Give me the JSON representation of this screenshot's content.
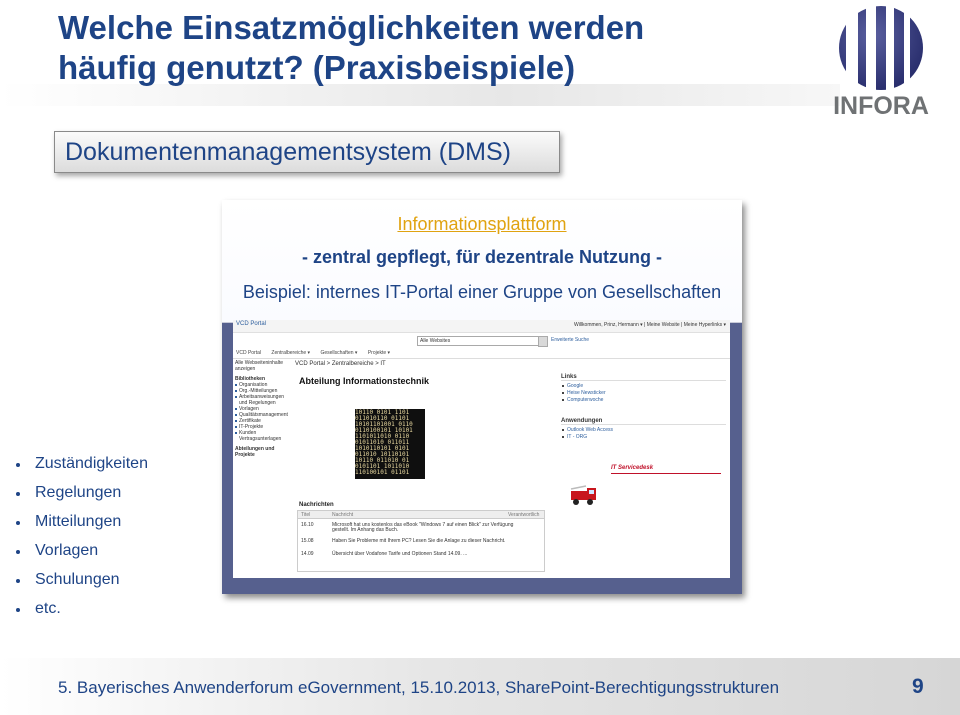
{
  "slide": {
    "title_line1": "Welche Einsatzmöglichkeiten werden",
    "title_line2": "häufig genutzt? (Praxisbeispiele)",
    "logo_text": "INFORA",
    "dms_label": "Dokumentenmanagementsystem (DMS)"
  },
  "panel": {
    "heading": "Informationsplattform",
    "subheading": "- zentral gepflegt, für dezentrale Nutzung -",
    "example": "Beispiel: internes IT-Portal einer Gruppe von Gesellschaften"
  },
  "portal": {
    "brand": "VCD Portal",
    "user_links": "Willkommen, Prinz, Hermann ▾ | Meine Website | Meine Hyperlinks ▾",
    "search_scope": "Alle Websites",
    "advanced_search": "Erweiterte Suche",
    "nav": [
      "VCD Portal",
      "Zentralbereiche ▾",
      "Gesellschaften ▾",
      "Projekte ▾"
    ],
    "breadcrumb": "VCD Portal > Zentralbereiche > IT",
    "left_nav": [
      {
        "label": "Alle Webseiteninhalte anzeigen",
        "type": "top"
      },
      {
        "label": "Bibliotheken",
        "type": "sec"
      },
      {
        "label": "Organisation",
        "type": "it"
      },
      {
        "label": "Org.-Mitteilungen",
        "type": "it"
      },
      {
        "label": "Arbeitsanweisungen und Regelungen",
        "type": "it"
      },
      {
        "label": "Vorlagen",
        "type": "it"
      },
      {
        "label": "Qualitätsmanagement",
        "type": "it"
      },
      {
        "label": "Zertifikate",
        "type": "it"
      },
      {
        "label": "IT-Projekte",
        "type": "it"
      },
      {
        "label": "Kunden Vertragsunterlagen",
        "type": "it"
      },
      {
        "label": "Abteilungen und Projekte",
        "type": "sec"
      }
    ],
    "department_title": "Abteilung Informationstechnik",
    "binary_lines": [
      "10110 0101 1101",
      "011010110 01101",
      "10101101001 0110",
      "0110100101 10101",
      "1101011010 0110",
      "01011010 011011",
      "1010110101 0101",
      "011010 10110101",
      "10110 011010 01",
      "0101101 1011010",
      "110100101 01101"
    ],
    "links_heading": "Links",
    "links": [
      "Google",
      "Heise Newsticker",
      "Computerwoche"
    ],
    "apps_heading": "Anwendungen",
    "apps": [
      "Outlook Web Access",
      "IT - ORG"
    ],
    "servicedesk": "IT Servicedesk",
    "news_heading": "Nachrichten",
    "news_cols": {
      "title": "Titel",
      "text": "Nachricht",
      "resp": "Verantwortlich"
    },
    "news": [
      {
        "date": "16.10",
        "text": "Microsoft hat uns kostenlos das eBook \"Windows 7 auf einen Blick\" zur Verfügung gestellt. Im Anhang das Buch."
      },
      {
        "date": "15.08",
        "text": "Haben Sie Probleme mit Ihrem PC? Lesen Sie die Anlage zu dieser Nachricht."
      },
      {
        "date": "14.09",
        "text": "Übersicht über Vodafone Tarife und Optionen Stand 14.09. ..."
      }
    ]
  },
  "bullets": [
    "Zuständigkeiten",
    "Regelungen",
    "Mitteilungen",
    "Vorlagen",
    "Schulungen",
    "etc."
  ],
  "footer": {
    "text": "5. Bayerisches Anwenderforum eGovernment, 15.10.2013, SharePoint-Berechtigungsstrukturen",
    "page": "9"
  },
  "colors": {
    "title_blue": "#1e4486",
    "panel_blue": "#56608e",
    "heading_gold": "#e0a311",
    "servicedesk_red": "#c0112a"
  }
}
